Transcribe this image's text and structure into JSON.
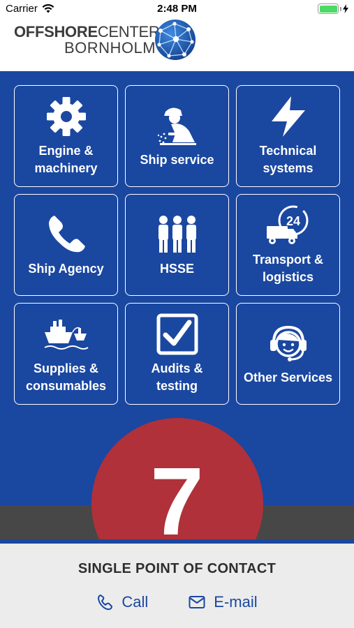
{
  "status_bar": {
    "carrier": "Carrier",
    "time": "2:48 PM"
  },
  "header": {
    "logo_bold": "OFFSHORE",
    "logo_light": "CENTER",
    "logo_sub": "BORNHOLM"
  },
  "tiles": [
    {
      "label": "Engine &\nmachinery",
      "icon": "gear-icon"
    },
    {
      "label": "Ship service",
      "icon": "worker-icon"
    },
    {
      "label": "Technical\nsystems",
      "icon": "lightning-icon"
    },
    {
      "label": "Ship Agency",
      "icon": "phone-icon"
    },
    {
      "label": "HSSE",
      "icon": "people-icon"
    },
    {
      "label": "Transport &\nlogistics",
      "icon": "truck-24-icon"
    },
    {
      "label": "Supplies &\nconsumables",
      "icon": "ships-icon"
    },
    {
      "label": "Audits &\ntesting",
      "icon": "checkbox-icon"
    },
    {
      "label": "Other Services",
      "icon": "headset-icon"
    }
  ],
  "badge": {
    "number": "7"
  },
  "footer": {
    "title": "SINGLE POINT OF CONTACT",
    "call_label": "Call",
    "email_label": "E-mail"
  },
  "colors": {
    "primary_blue": "#1a47a0",
    "badge_red": "#b0313a",
    "footer_bg": "#ececec",
    "dark_band": "#474747"
  }
}
